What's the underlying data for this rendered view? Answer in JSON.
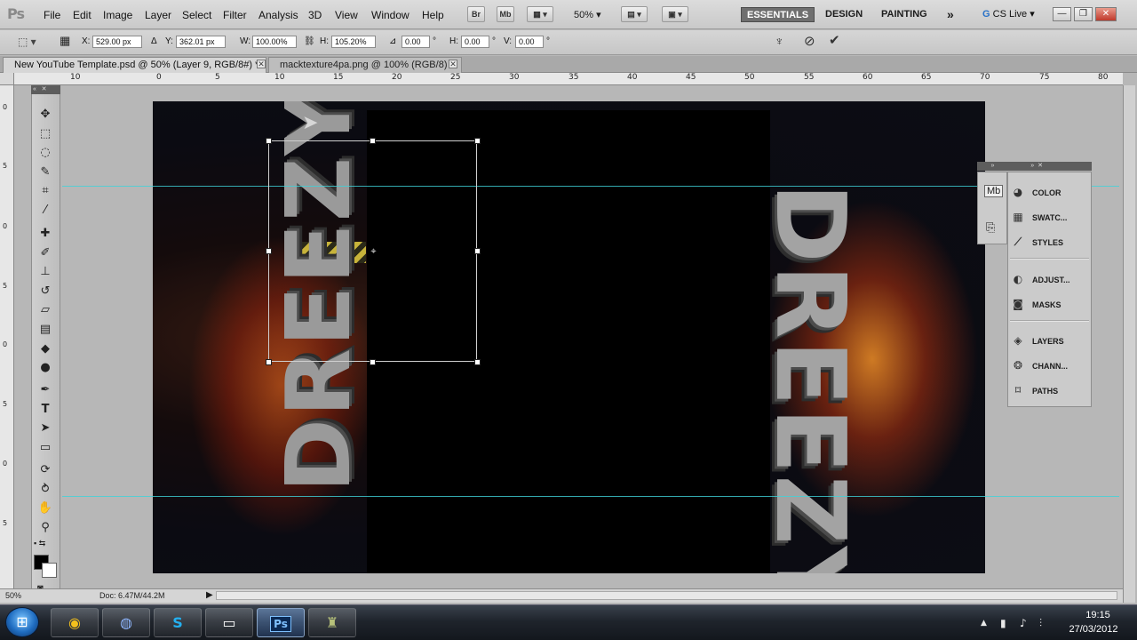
{
  "app": {
    "logo": "Ps",
    "menu": [
      "File",
      "Edit",
      "Image",
      "Layer",
      "Select",
      "Filter",
      "Analysis",
      "3D",
      "View",
      "Window",
      "Help"
    ],
    "bridge_label": "Br",
    "minibridge_label": "Mb",
    "zoom_level": "50%",
    "workspaces": [
      "ESSENTIALS",
      "DESIGN",
      "PAINTING"
    ],
    "more_workspaces": "»",
    "cs_live": "CS Live",
    "window_buttons": [
      "—",
      "❐",
      "✕"
    ]
  },
  "options": {
    "x_label": "X:",
    "x_value": "529.00 px",
    "y_label": "Y:",
    "y_value": "362.01 px",
    "w_label": "W:",
    "w_value": "100.00%",
    "h_label": "H:",
    "h_value": "105.20%",
    "angle_value": "0.00",
    "angle_unit": "°",
    "hskew_label": "H:",
    "hskew_value": "0.00",
    "vskew_label": "V:",
    "vskew_value": "0.00",
    "cancel_icon": "cancel-icon",
    "commit_icon": "commit-icon"
  },
  "tabs": [
    {
      "label": "New YouTube Template.psd @ 50% (Layer 9, RGB/8#) *",
      "active": true
    },
    {
      "label": "macktexture4pa.png @ 100% (RGB/8)",
      "active": false
    }
  ],
  "ruler_h": [
    "10",
    "0",
    "5",
    "10",
    "15",
    "20",
    "25",
    "30",
    "35",
    "40",
    "45",
    "50",
    "55",
    "60",
    "65",
    "70",
    "75",
    "80"
  ],
  "ruler_v": [
    "0",
    "5",
    "0",
    "5",
    "0",
    "5",
    "0",
    "5"
  ],
  "canvas": {
    "artwork_text_left": "DREEZY",
    "artwork_text_right": "DREEZY"
  },
  "panels": [
    {
      "label": "COLOR",
      "icon": "color-icon"
    },
    {
      "label": "SWATC...",
      "icon": "swatches-icon"
    },
    {
      "label": "STYLES",
      "icon": "styles-icon"
    },
    {
      "label": "ADJUST...",
      "icon": "adjustments-icon"
    },
    {
      "label": "MASKS",
      "icon": "masks-icon"
    },
    {
      "label": "LAYERS",
      "icon": "layers-icon"
    },
    {
      "label": "CHANN...",
      "icon": "channels-icon"
    },
    {
      "label": "PATHS",
      "icon": "paths-icon"
    }
  ],
  "status": {
    "zoom": "50%",
    "doc": "Doc: 6.47M/44.2M"
  },
  "taskbar": {
    "apps": [
      "chrome",
      "cinema4d",
      "skype",
      "media",
      "photoshop",
      "game"
    ],
    "ps_label": "Ps",
    "time": "19:15",
    "date": "27/03/2012"
  }
}
